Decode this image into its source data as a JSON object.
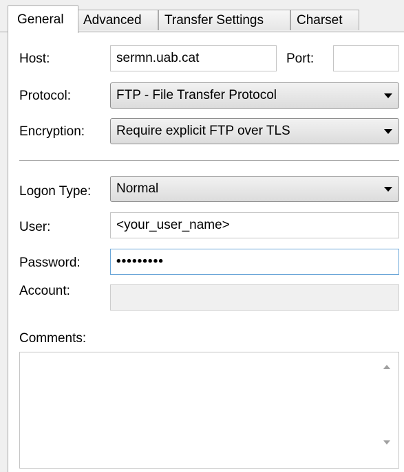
{
  "tabs": [
    {
      "label": "General",
      "active": true
    },
    {
      "label": "Advanced",
      "active": false
    },
    {
      "label": "Transfer Settings",
      "active": false
    },
    {
      "label": "Charset",
      "active": false
    }
  ],
  "form": {
    "host": {
      "label": "Host:",
      "value": "sermn.uab.cat"
    },
    "port": {
      "label": "Port:",
      "value": ""
    },
    "protocol": {
      "label": "Protocol:",
      "value": "FTP - File Transfer Protocol"
    },
    "encryption": {
      "label": "Encryption:",
      "value": "Require explicit FTP over TLS"
    },
    "logon_type": {
      "label": "Logon Type:",
      "value": "Normal"
    },
    "user": {
      "label": "User:",
      "value": "<your_user_name>"
    },
    "password": {
      "label": "Password:",
      "value": "•••••••••"
    },
    "account": {
      "label": "Account:",
      "value": ""
    },
    "comments": {
      "label": "Comments:",
      "value": ""
    }
  }
}
